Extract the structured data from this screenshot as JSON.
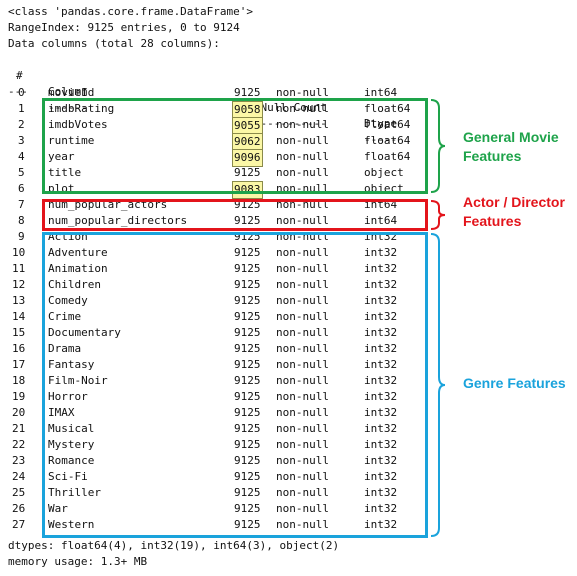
{
  "header": {
    "class_line": "<class 'pandas.core.frame.DataFrame'>",
    "range_line": "RangeIndex: 9125 entries, 0 to 9124",
    "columns_line": "Data columns (total 28 columns):",
    "col_hash": "#",
    "col_column": "Column",
    "col_count": "Non-Null Count",
    "col_dtype": "Dtype",
    "sep_hash": "---",
    "sep_column": "------",
    "sep_count": "--------------",
    "sep_dtype": "-----"
  },
  "rows": [
    {
      "idx": "0",
      "name": "movieId",
      "count": "9125",
      "null": "non-null",
      "dtype": "int64",
      "highlight": false
    },
    {
      "idx": "1",
      "name": "imdbRating",
      "count": "9058",
      "null": "non-null",
      "dtype": "float64",
      "highlight": true
    },
    {
      "idx": "2",
      "name": "imdbVotes",
      "count": "9055",
      "null": "non-null",
      "dtype": "float64",
      "highlight": true
    },
    {
      "idx": "3",
      "name": "runtime",
      "count": "9062",
      "null": "non-null",
      "dtype": "float64",
      "highlight": true
    },
    {
      "idx": "4",
      "name": "year",
      "count": "9096",
      "null": "non-null",
      "dtype": "float64",
      "highlight": true
    },
    {
      "idx": "5",
      "name": "title",
      "count": "9125",
      "null": "non-null",
      "dtype": "object",
      "highlight": false
    },
    {
      "idx": "6",
      "name": "plot",
      "count": "9083",
      "null": "non-null",
      "dtype": "object",
      "highlight": true
    },
    {
      "idx": "7",
      "name": "num_popular_actors",
      "count": "9125",
      "null": "non-null",
      "dtype": "int64",
      "highlight": false
    },
    {
      "idx": "8",
      "name": "num_popular_directors",
      "count": "9125",
      "null": "non-null",
      "dtype": "int64",
      "highlight": false
    },
    {
      "idx": "9",
      "name": "Action",
      "count": "9125",
      "null": "non-null",
      "dtype": "int32",
      "highlight": false
    },
    {
      "idx": "10",
      "name": "Adventure",
      "count": "9125",
      "null": "non-null",
      "dtype": "int32",
      "highlight": false
    },
    {
      "idx": "11",
      "name": "Animation",
      "count": "9125",
      "null": "non-null",
      "dtype": "int32",
      "highlight": false
    },
    {
      "idx": "12",
      "name": "Children",
      "count": "9125",
      "null": "non-null",
      "dtype": "int32",
      "highlight": false
    },
    {
      "idx": "13",
      "name": "Comedy",
      "count": "9125",
      "null": "non-null",
      "dtype": "int32",
      "highlight": false
    },
    {
      "idx": "14",
      "name": "Crime",
      "count": "9125",
      "null": "non-null",
      "dtype": "int32",
      "highlight": false
    },
    {
      "idx": "15",
      "name": "Documentary",
      "count": "9125",
      "null": "non-null",
      "dtype": "int32",
      "highlight": false
    },
    {
      "idx": "16",
      "name": "Drama",
      "count": "9125",
      "null": "non-null",
      "dtype": "int32",
      "highlight": false
    },
    {
      "idx": "17",
      "name": "Fantasy",
      "count": "9125",
      "null": "non-null",
      "dtype": "int32",
      "highlight": false
    },
    {
      "idx": "18",
      "name": "Film-Noir",
      "count": "9125",
      "null": "non-null",
      "dtype": "int32",
      "highlight": false
    },
    {
      "idx": "19",
      "name": "Horror",
      "count": "9125",
      "null": "non-null",
      "dtype": "int32",
      "highlight": false
    },
    {
      "idx": "20",
      "name": "IMAX",
      "count": "9125",
      "null": "non-null",
      "dtype": "int32",
      "highlight": false
    },
    {
      "idx": "21",
      "name": "Musical",
      "count": "9125",
      "null": "non-null",
      "dtype": "int32",
      "highlight": false
    },
    {
      "idx": "22",
      "name": "Mystery",
      "count": "9125",
      "null": "non-null",
      "dtype": "int32",
      "highlight": false
    },
    {
      "idx": "23",
      "name": "Romance",
      "count": "9125",
      "null": "non-null",
      "dtype": "int32",
      "highlight": false
    },
    {
      "idx": "24",
      "name": "Sci-Fi",
      "count": "9125",
      "null": "non-null",
      "dtype": "int32",
      "highlight": false
    },
    {
      "idx": "25",
      "name": "Thriller",
      "count": "9125",
      "null": "non-null",
      "dtype": "int32",
      "highlight": false
    },
    {
      "idx": "26",
      "name": "War",
      "count": "9125",
      "null": "non-null",
      "dtype": "int32",
      "highlight": false
    },
    {
      "idx": "27",
      "name": "Western",
      "count": "9125",
      "null": "non-null",
      "dtype": "int32",
      "highlight": false
    }
  ],
  "footer": {
    "dtypes_line": "dtypes: float64(4), int32(19), int64(3), object(2)",
    "memory_line": "memory usage: 1.3+ MB"
  },
  "groups": {
    "general": {
      "label_1": "General Movie",
      "label_2": "Features",
      "color": "#1ea34a"
    },
    "actor": {
      "label_1": "Actor / Director",
      "label_2": "Features",
      "color": "#e3141b"
    },
    "genre": {
      "label_1": "Genre Features",
      "color": "#1aa3dc"
    }
  },
  "highlight_color": "#fbf7a6"
}
